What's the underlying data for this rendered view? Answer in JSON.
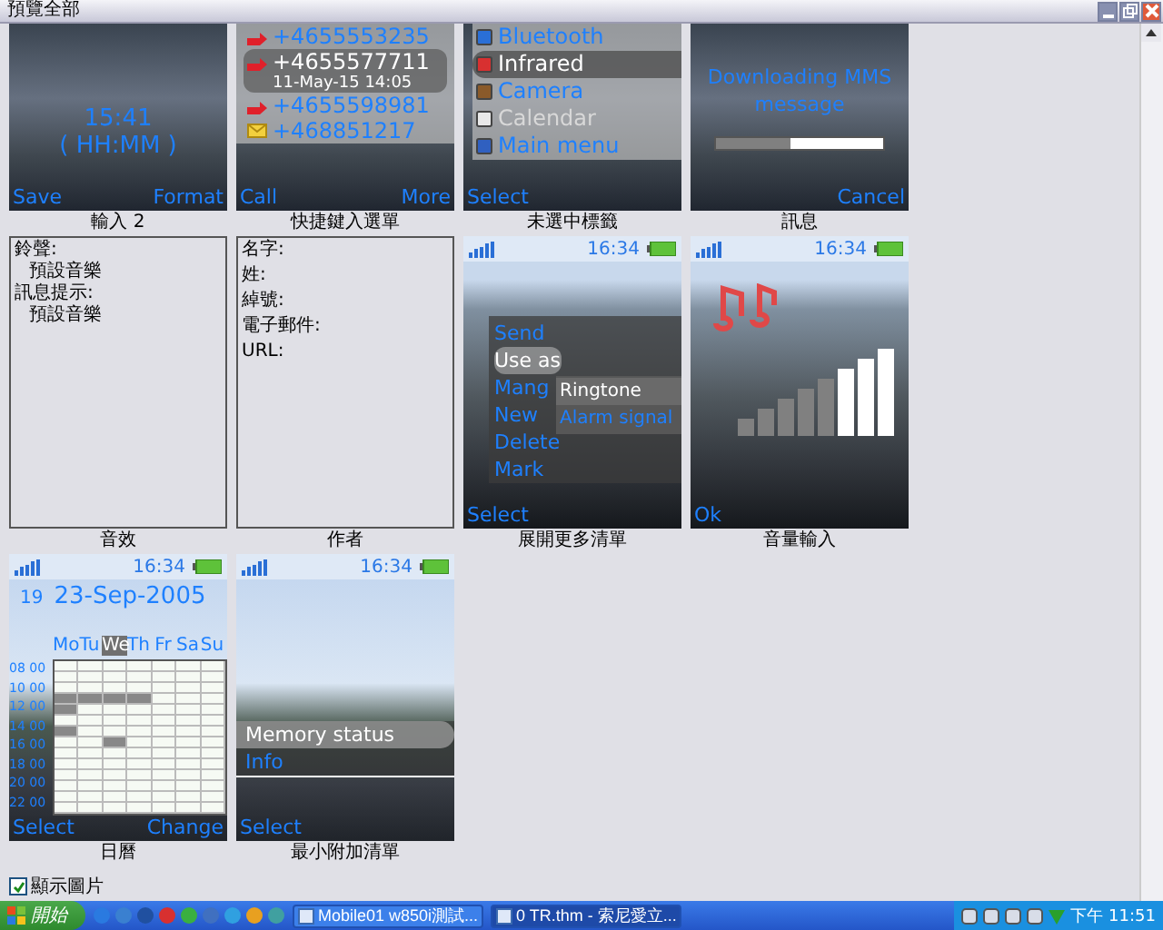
{
  "window": {
    "title": "預覽全部"
  },
  "rows": [
    {
      "cells": [
        {
          "kind": "clock",
          "caption": "輸入 2",
          "value": "15:41",
          "hint": "( HH:MM )",
          "softkeys": {
            "left": "Save",
            "right": "Format"
          }
        },
        {
          "kind": "calls",
          "caption": "快捷鍵入選單",
          "entries": [
            {
              "kind": "call",
              "number": "+4655553235",
              "selected": false
            },
            {
              "kind": "call",
              "number": "+4655577711",
              "selected": true,
              "detail": "11-May-15   14:05"
            },
            {
              "kind": "call",
              "number": "+4655598981",
              "selected": false
            },
            {
              "kind": "message",
              "number": "+468851217",
              "selected": false
            }
          ],
          "softkeys": {
            "left": "Call",
            "right": "More"
          }
        },
        {
          "kind": "menu",
          "caption": "未選中標籤",
          "items": [
            {
              "label": "Bluetooth",
              "selected": false,
              "disabled": false
            },
            {
              "label": "Infrared",
              "selected": true,
              "disabled": false
            },
            {
              "label": "Camera",
              "selected": false,
              "disabled": false
            },
            {
              "label": "Calendar",
              "selected": false,
              "disabled": true
            },
            {
              "label": "Main menu",
              "selected": false,
              "disabled": false
            }
          ],
          "softkeys": {
            "left": "Select"
          }
        },
        {
          "kind": "download",
          "caption": "訊息",
          "message": "Downloading MMS message",
          "level": 0.45,
          "softkeys": {
            "right": "Cancel"
          }
        }
      ]
    },
    {
      "cells": [
        {
          "kind": "fields",
          "caption": "音效",
          "lines": [
            {
              "label": "鈴聲:",
              "value": "預設音樂"
            },
            {
              "label": "訊息提示:",
              "value": "預設音樂"
            }
          ]
        },
        {
          "kind": "fields",
          "caption": "作者",
          "lines": [
            {
              "label": "名字:"
            },
            {
              "label": "姓:"
            },
            {
              "label": "綽號:"
            },
            {
              "label": "電子郵件:"
            },
            {
              "label": "URL:"
            }
          ]
        },
        {
          "kind": "popup",
          "caption": "展開更多清單",
          "time": "16:34",
          "items": [
            {
              "label": "Send",
              "selected": false
            },
            {
              "label": "Use as",
              "selected": true
            },
            {
              "label": "Mang",
              "selected": false
            },
            {
              "label": "New",
              "selected": false
            },
            {
              "label": "Delete",
              "selected": false
            },
            {
              "label": "Mark",
              "selected": false
            }
          ],
          "submenu": [
            {
              "label": "Ringtone",
              "selected": true
            },
            {
              "label": "Alarm signal",
              "selected": false
            }
          ],
          "softkeys": {
            "left": "Select"
          }
        },
        {
          "kind": "volume",
          "caption": "音量輸入",
          "time": "16:34",
          "level": 0.625,
          "softkeys": {
            "left": "Ok"
          }
        }
      ]
    },
    {
      "cells": [
        {
          "kind": "calendar",
          "caption": "日曆",
          "time": "16:34",
          "week": "19",
          "date": "23-Sep-2005",
          "days": [
            {
              "label": "Mo",
              "selected": false
            },
            {
              "label": "Tu",
              "selected": false
            },
            {
              "label": "We",
              "selected": true
            },
            {
              "label": "Th",
              "selected": false
            },
            {
              "label": "Fr",
              "selected": false
            },
            {
              "label": "Sa",
              "selected": false
            },
            {
              "label": "Su",
              "selected": false
            }
          ],
          "hours": [
            "08 00",
            "10 00",
            "12 00",
            "14 00",
            "16 00",
            "18 00",
            "20 00",
            "22 00"
          ],
          "softkeys": {
            "left": "Select",
            "right": "Change"
          }
        },
        {
          "kind": "mini",
          "caption": "最小附加清單",
          "time": "16:34",
          "items": [
            {
              "label": "Memory status",
              "selected": true
            },
            {
              "label": "Info",
              "selected": false
            }
          ],
          "softkeys": {
            "left": "Select"
          }
        }
      ]
    }
  ],
  "show_images": {
    "label": "顯示圖片",
    "checked": true
  },
  "taskbar": {
    "start": "開始",
    "tasks": [
      {
        "label": "Mobile01 w850i測試...",
        "selected": false
      },
      {
        "label": "0 TR.thm - 索尼愛立...",
        "selected": true
      }
    ],
    "clock": "下午 11:51"
  }
}
